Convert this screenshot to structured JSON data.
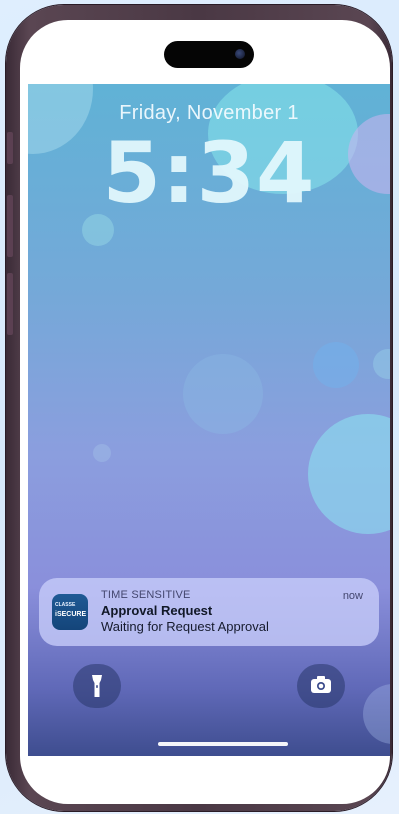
{
  "lock_screen": {
    "date": "Friday, November 1",
    "time": "5:34"
  },
  "notification": {
    "app_icon_line1": "CLASSE",
    "app_icon_line2": "iSECURE",
    "category": "TIME SENSITIVE",
    "timestamp": "now",
    "title": "Approval Request",
    "body": "Waiting for Request Approval"
  },
  "quick_actions": {
    "left_icon": "flashlight-icon",
    "right_icon": "camera-icon"
  },
  "colors": {
    "frame": "#4a3844",
    "wallpaper_top": "#60b2d6",
    "wallpaper_bottom": "#3e4d8f",
    "notification_bg": "#c8cdfa"
  }
}
